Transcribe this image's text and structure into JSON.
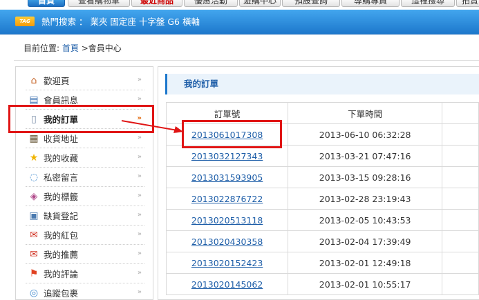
{
  "nav": {
    "tabs": [
      {
        "label": "首頁"
      },
      {
        "label": "查看購物車"
      },
      {
        "label": "最近商品"
      },
      {
        "label": "優惠活動"
      },
      {
        "label": "遊購中心"
      },
      {
        "label": "預設查詢"
      },
      {
        "label": "導購專員"
      },
      {
        "label": "這裡搜尋"
      },
      {
        "label": "拍賣"
      }
    ]
  },
  "hot_search": {
    "tag_text": "TAG",
    "label": "熱門搜索 ： 業夾 固定座 十字盤 G6 橫軸"
  },
  "breadcrumb": {
    "prefix": "目前位置:",
    "home": "首頁",
    "separator": ">",
    "current": "會員中心"
  },
  "sidebar": {
    "items": [
      {
        "label": "歡迎頁",
        "icon": "house-icon"
      },
      {
        "label": "會員訊息",
        "icon": "id-card-icon"
      },
      {
        "label": "我的訂單",
        "icon": "document-icon"
      },
      {
        "label": "收貨地址",
        "icon": "address-book-icon"
      },
      {
        "label": "我的收藏",
        "icon": "star-icon"
      },
      {
        "label": "私密留言",
        "icon": "speech-bubble-icon"
      },
      {
        "label": "我的標籤",
        "icon": "tag-icon"
      },
      {
        "label": "缺貨登記",
        "icon": "clipboard-icon"
      },
      {
        "label": "我的紅包",
        "icon": "red-envelope-icon"
      },
      {
        "label": "我的推薦",
        "icon": "recommend-icon"
      },
      {
        "label": "我的評論",
        "icon": "flag-icon"
      },
      {
        "label": "追蹤包裹",
        "icon": "package-icon"
      }
    ],
    "arrow_glyph": "»",
    "active_index": 2
  },
  "content": {
    "title": "我的訂單",
    "columns": [
      "訂單號",
      "下單時間",
      ""
    ],
    "orders": [
      {
        "number": "2013061017308",
        "time": "2013-06-10 06:32:28"
      },
      {
        "number": "2013032127343",
        "time": "2013-03-21 07:47:16"
      },
      {
        "number": "2013031593905",
        "time": "2013-03-15 09:28:16"
      },
      {
        "number": "2013022876722",
        "time": "2013-02-28 23:19:43"
      },
      {
        "number": "2013020513118",
        "time": "2013-02-05 10:43:53"
      },
      {
        "number": "2013020430358",
        "time": "2013-02-04 17:39:49"
      },
      {
        "number": "2013020152423",
        "time": "2013-02-01 12:49:18"
      },
      {
        "number": "2013020145062",
        "time": "2013-02-01 10:55:17"
      }
    ]
  },
  "colors": {
    "accent_blue": "#1d78cc",
    "link_blue": "#1e5ea8",
    "annotation_red": "#e01515"
  }
}
